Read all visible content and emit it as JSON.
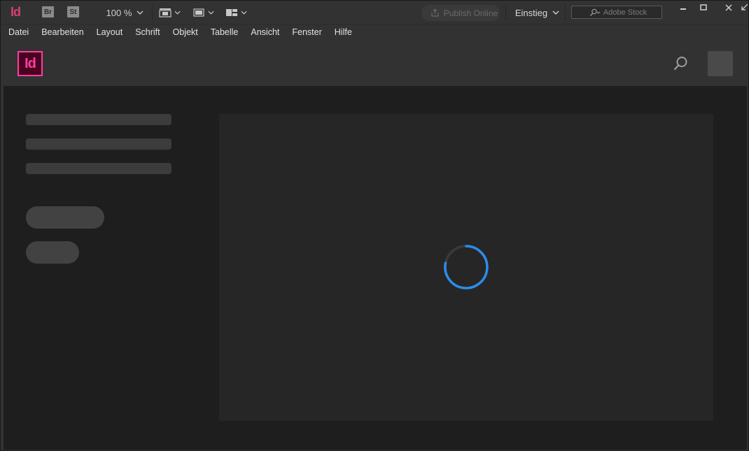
{
  "app": {
    "logo_text": "Id",
    "bridge_label": "Br",
    "stock_label": "St",
    "zoom_value": "100 %",
    "publish_label": "Publish Online",
    "workspace_label": "Einstieg",
    "stock_search_placeholder": "Adobe Stock"
  },
  "menu": {
    "items": [
      "Datei",
      "Bearbeiten",
      "Layout",
      "Schrift",
      "Objekt",
      "Tabelle",
      "Ansicht",
      "Fenster",
      "Hilfe"
    ]
  },
  "start_screen": {
    "logo_text": "Id",
    "state": "loading"
  },
  "colors": {
    "accent": "#ff3ea5",
    "spinner": "#2d8ceb",
    "background": "#1e1e1e"
  }
}
